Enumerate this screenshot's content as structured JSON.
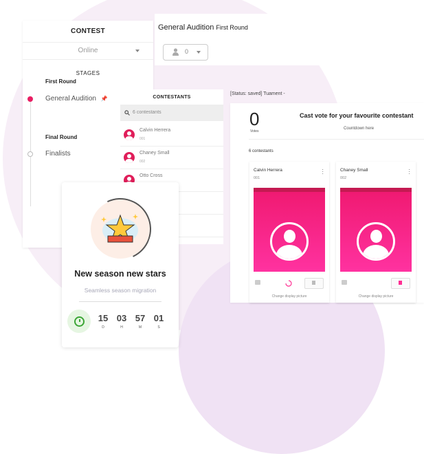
{
  "left_panel": {
    "header": "CONTEST",
    "mode_select": "Online",
    "stages_label": "STAGES",
    "rounds": [
      {
        "title": "First Round",
        "stage": "General Audition",
        "active": true
      },
      {
        "title": "Final Round",
        "stage": "Finalists",
        "active": false
      }
    ]
  },
  "topbar": {
    "title": "General Audition",
    "subtitle": "First Round",
    "user_count": "0"
  },
  "contestants_list": {
    "header": "CONTESTANTS",
    "search_placeholder": "6 contestants",
    "rows": [
      {
        "name": "Calvin Herrera",
        "id": "001"
      },
      {
        "name": "Chaney Small",
        "id": "002"
      },
      {
        "name": "Otto Cross",
        "id": ""
      }
    ]
  },
  "main": {
    "status": "[Status: saved] Tuament -",
    "votes_value": "0",
    "votes_label": "Votes",
    "cast_vote": "Cast vote for your favourite contestant",
    "countdown": "Countdown here",
    "contestants_count": "6 contestants",
    "cards": [
      {
        "name": "Calvin Herrera",
        "id": "001",
        "change_picture": "Change display picture"
      },
      {
        "name": "Chaney Small",
        "id": "002",
        "change_picture": "Change display picture"
      }
    ]
  },
  "promo": {
    "title": "New season new stars",
    "subtitle": "Seamless season migration",
    "timer": [
      {
        "value": "15",
        "label": "D"
      },
      {
        "value": "03",
        "label": "H"
      },
      {
        "value": "57",
        "label": "M"
      },
      {
        "value": "01",
        "label": "S"
      }
    ]
  },
  "colors": {
    "accent": "#e91e63",
    "avatar_pink": "#ff2d92",
    "timer_green": "#3ba635"
  }
}
